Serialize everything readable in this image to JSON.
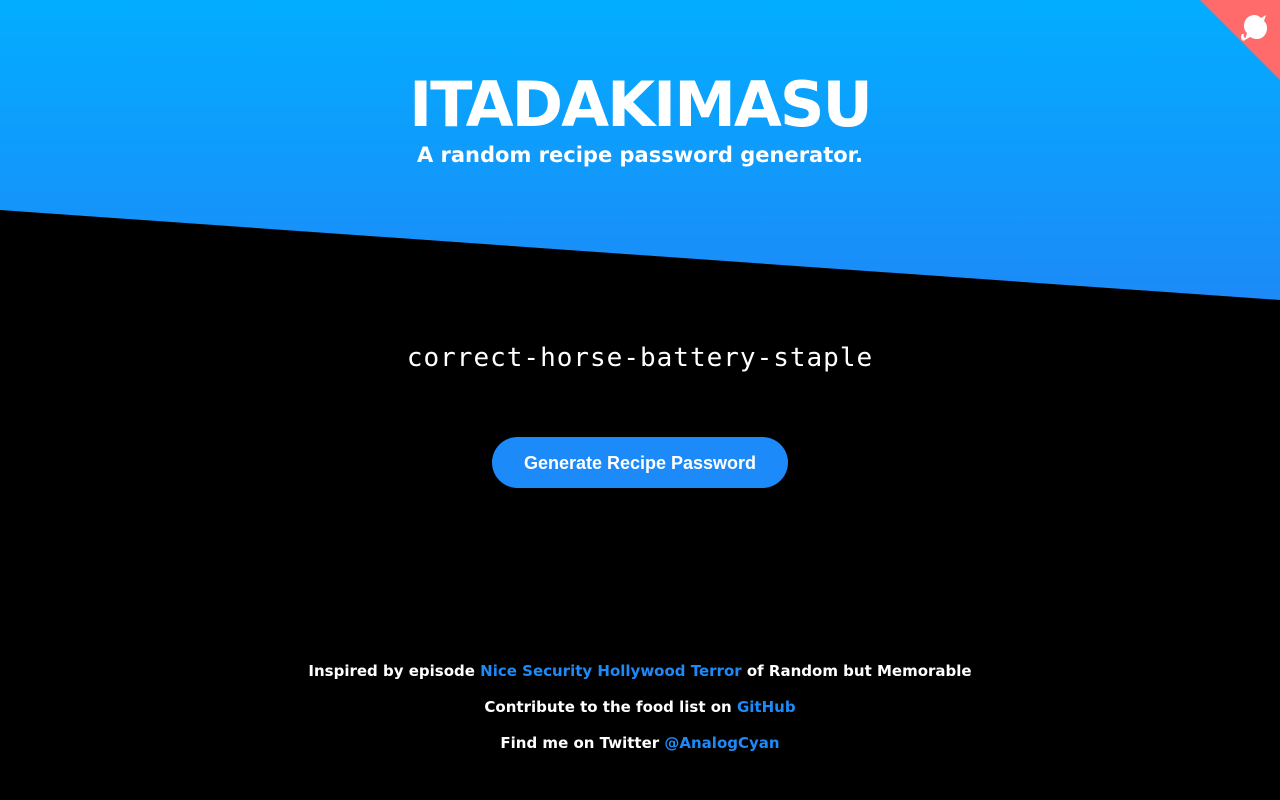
{
  "header": {
    "title": "ITADAKIMASU",
    "subtitle": "A random recipe password generator."
  },
  "corner": {
    "icon": "octocat-icon",
    "color": "#ff6b6b"
  },
  "main": {
    "password": "correct-horse-battery-staple",
    "generate_button_label": "Generate Recipe Password"
  },
  "footer": {
    "line1_prefix": "Inspired by episode ",
    "line1_link": "Nice Security Hollywood Terror",
    "line1_suffix": " of Random but Memorable",
    "line2_prefix": "Contribute to the food list on ",
    "line2_link": "GitHub",
    "line3_prefix": "Find me on Twitter ",
    "line3_link": "@AnalogCyan"
  },
  "colors": {
    "gradient_top": "#02adff",
    "gradient_bottom": "#1c8af8",
    "accent": "#1c8af8",
    "background": "#000000",
    "corner": "#ff6b6b"
  }
}
